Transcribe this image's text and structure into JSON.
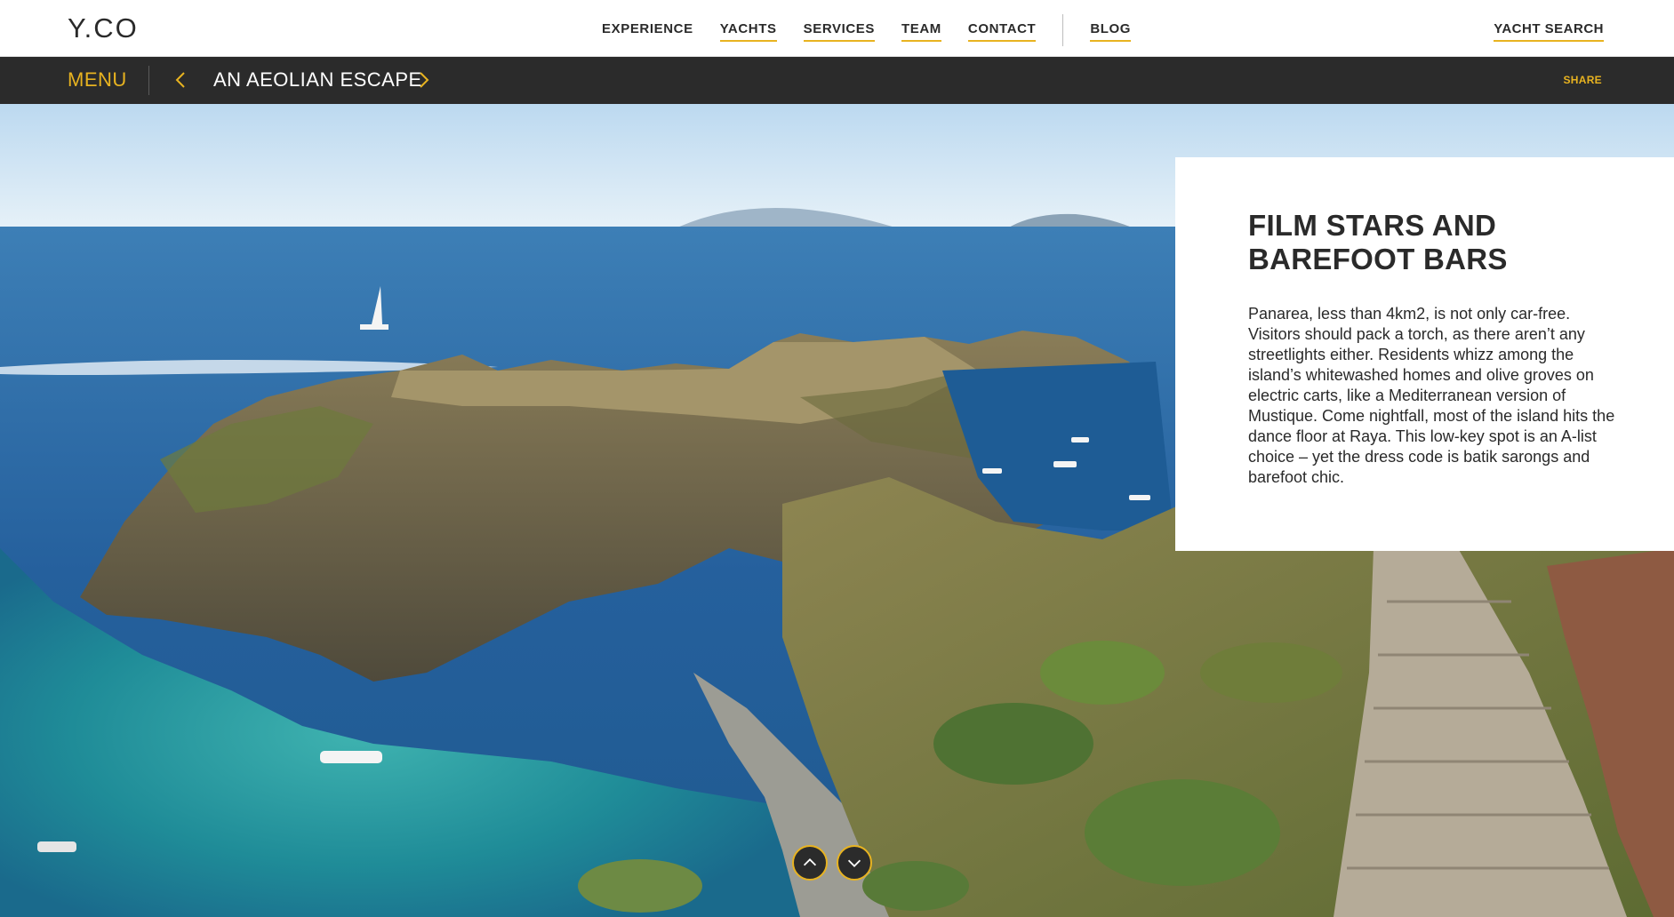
{
  "header": {
    "logo": "Y.CO",
    "nav": [
      {
        "label": "EXPERIENCE"
      },
      {
        "label": "YACHTS"
      },
      {
        "label": "SERVICES"
      },
      {
        "label": "TEAM"
      },
      {
        "label": "CONTACT"
      },
      {
        "label": "BLOG"
      }
    ],
    "yacht_search": "YACHT SEARCH"
  },
  "subbar": {
    "menu": "MENU",
    "title": "AN AEOLIAN ESCAPE",
    "share": "SHARE",
    "prev_icon": "chevron-left-icon",
    "next_icon": "chevron-right-icon"
  },
  "hero": {
    "scene": "coastal-island-photo"
  },
  "card": {
    "heading": "FILM STARS AND BAREFOOT BARS",
    "body": "Panarea, less than 4km2, is not only car-free. Visitors should pack a torch, as there aren’t any streetlights either. Residents whizz among the island’s whitewashed homes and olive groves on electric carts, like a Mediterranean version of Mustique. Come nightfall, most of the island hits the dance floor at Raya. This low-key spot is an A-list choice – yet the dress code is batik sarongs and barefoot chic."
  },
  "controls": {
    "up_icon": "chevron-up-icon",
    "down_icon": "chevron-down-icon"
  },
  "colors": {
    "accent": "#e8b320",
    "bar": "#2b2b2b",
    "text": "#2a2a2a"
  }
}
